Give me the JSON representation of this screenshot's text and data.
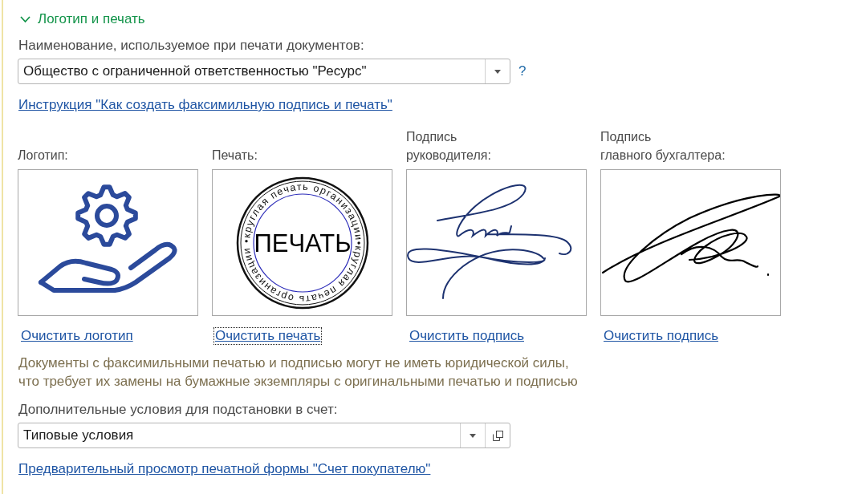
{
  "section": {
    "title": "Логотип и печать",
    "expanded": true
  },
  "print_name": {
    "label": "Наименование, используемое при печати документов:",
    "value": "Общество с ограниченной ответственностью \"Ресурс\"",
    "help": "?"
  },
  "instruction_link": "Инструкция \"Как создать факсимильную подпись и печать\"",
  "images": [
    {
      "label": "Логотип:",
      "kind": "logo",
      "clear_link": "Очистить логотип",
      "focused": false
    },
    {
      "label": "Печать:",
      "kind": "stamp",
      "stamp_text": "ПЕЧАТЬ",
      "ring_text": "•круглая печать организации•круглая печать организации",
      "clear_link": "Очистить печать",
      "focused": true
    },
    {
      "label": "Подпись\nруководителя:",
      "kind": "signature_a",
      "clear_link": "Очистить подпись",
      "focused": false
    },
    {
      "label": "Подпись\nглавного бухгалтера:",
      "kind": "signature_b",
      "clear_link": "Очистить подпись",
      "focused": false
    }
  ],
  "warning": "Документы с факсимильными печатью и подписью могут не иметь юридической силы,\nчто требует их замены на бумажные экземпляры с оригинальными печатью и подписью",
  "conditions": {
    "label": "Дополнительные условия для подстановки в счет:",
    "value": "Типовые условия"
  },
  "preview_link": "Предварительный просмотр печатной формы \"Счет покупателю\""
}
